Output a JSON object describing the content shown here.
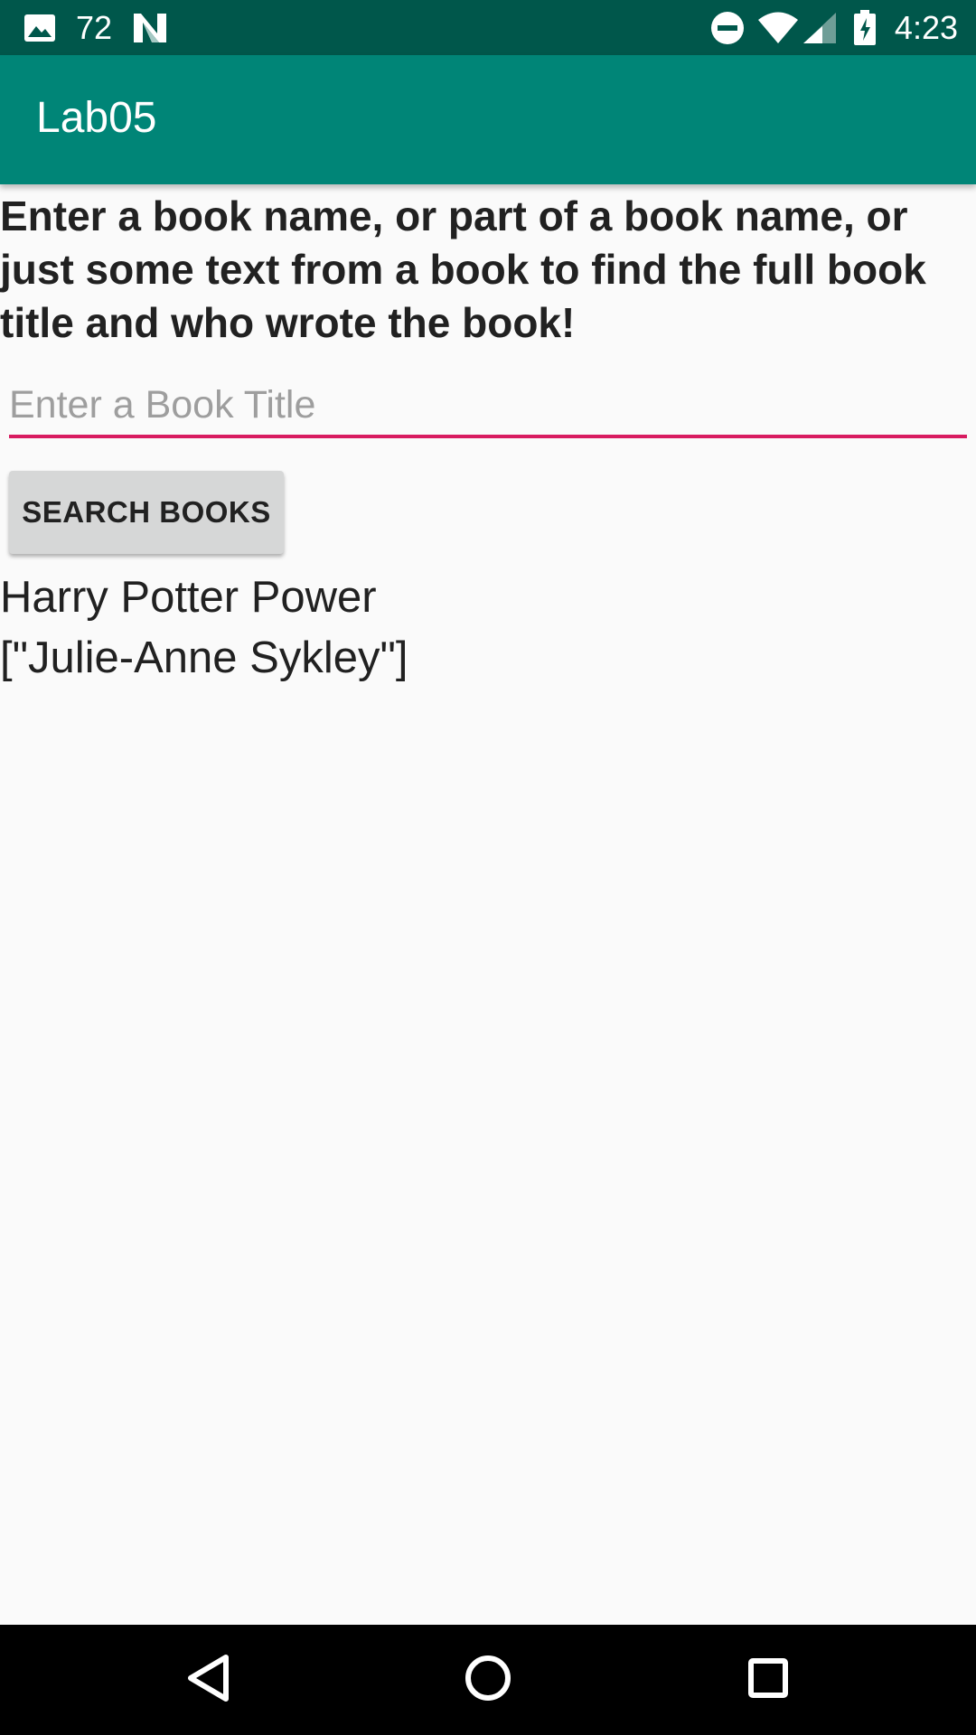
{
  "status_bar": {
    "notification_count": "72",
    "time": "4:23"
  },
  "app_bar": {
    "title": "Lab05"
  },
  "main": {
    "instructions": "Enter a book name, or part of a book name, or just some text from a book to find the full book title and who wrote the book!",
    "search": {
      "value": "",
      "placeholder": "Enter a Book Title"
    },
    "search_button_label": "SEARCH BOOKS",
    "result": {
      "title": "Harry Potter Power",
      "authors": "[\"Julie-Anne Sykley\"]"
    }
  },
  "colors": {
    "status_bar": "#00574b",
    "app_bar": "#008577",
    "accent": "#d81b60",
    "background": "#fafafa"
  },
  "icons": {
    "status_left": [
      "image-icon",
      "n-logo-icon"
    ],
    "status_right": [
      "do-not-disturb-icon",
      "wifi-icon",
      "cell-signal-icon",
      "battery-charging-icon"
    ],
    "nav": [
      "back-icon",
      "home-icon",
      "recents-icon"
    ]
  }
}
